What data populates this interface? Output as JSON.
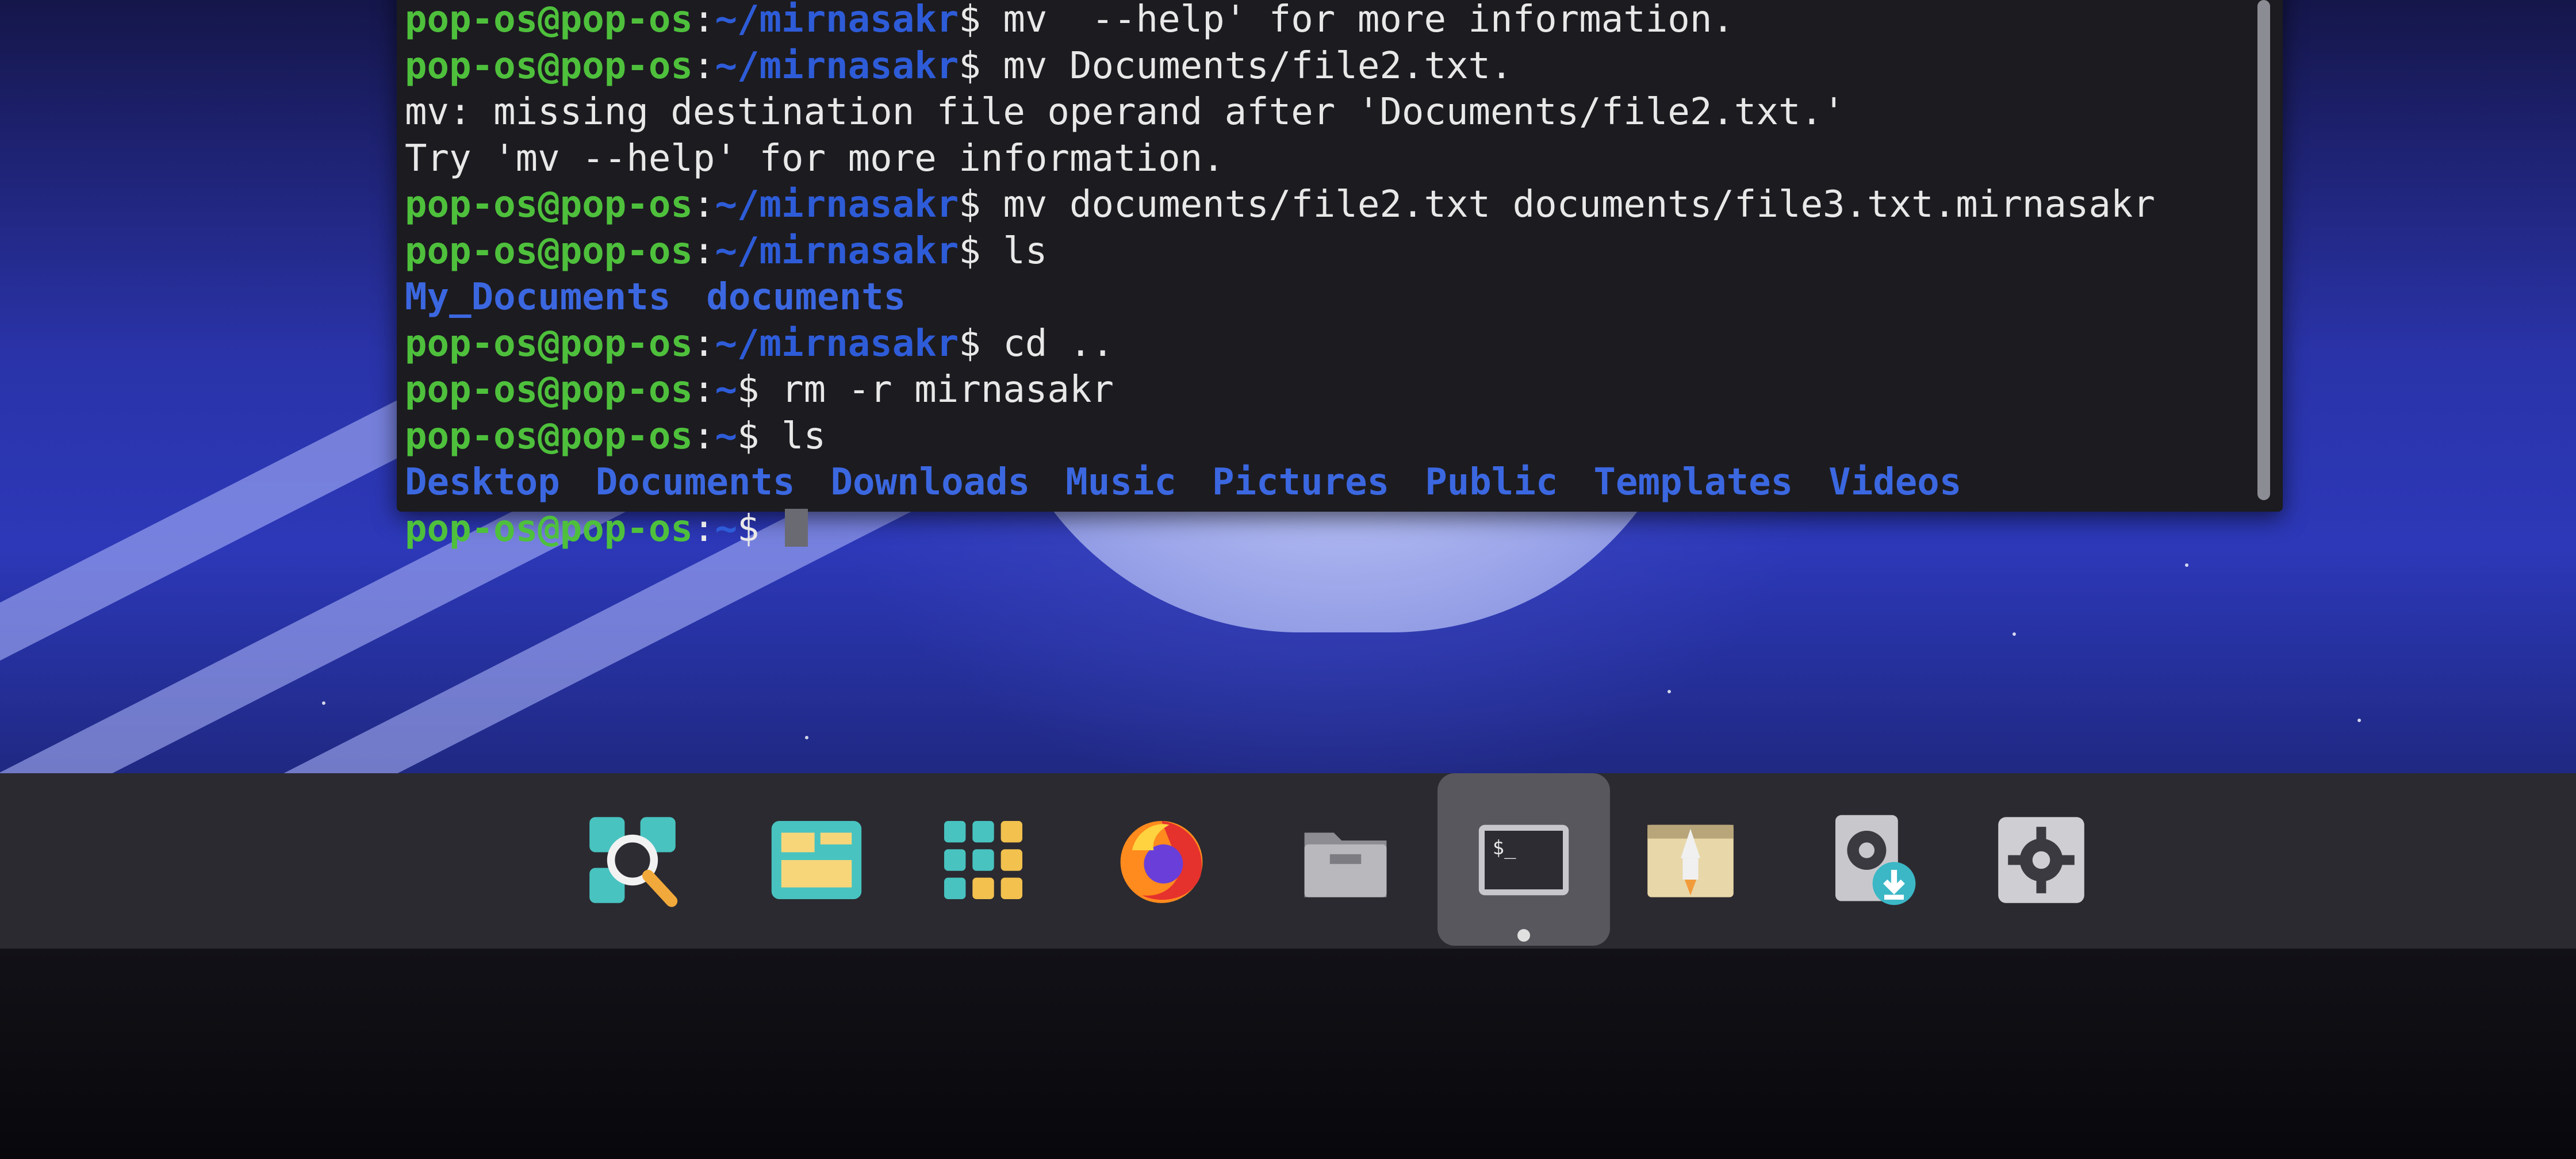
{
  "terminal": {
    "lines": [
      {
        "type": "cmd",
        "user": "pop-os@pop-os",
        "sep": ":",
        "path": "~/mirnasakr",
        "prompt": "$",
        "cmd": " mv  --help' for more information."
      },
      {
        "type": "cmd",
        "user": "pop-os@pop-os",
        "sep": ":",
        "path": "~/mirnasakr",
        "prompt": "$",
        "cmd": " mv Documents/file2.txt."
      },
      {
        "type": "out",
        "text": "mv: missing destination file operand after 'Documents/file2.txt.'"
      },
      {
        "type": "out",
        "text": "Try 'mv --help' for more information."
      },
      {
        "type": "cmd",
        "user": "pop-os@pop-os",
        "sep": ":",
        "path": "~/mirnasakr",
        "prompt": "$",
        "cmd": " mv documents/file2.txt documents/file3.txt.mirnasakr"
      },
      {
        "type": "cmd",
        "user": "pop-os@pop-os",
        "sep": ":",
        "path": "~/mirnasakr",
        "prompt": "$",
        "cmd": " ls"
      },
      {
        "type": "dirs",
        "items": [
          "My_Documents",
          "documents"
        ]
      },
      {
        "type": "cmd",
        "user": "pop-os@pop-os",
        "sep": ":",
        "path": "~/mirnasakr",
        "prompt": "$",
        "cmd": " cd .."
      },
      {
        "type": "cmd",
        "user": "pop-os@pop-os",
        "sep": ":",
        "path": "~",
        "prompt": "$",
        "cmd": " rm -r mirnasakr"
      },
      {
        "type": "cmd",
        "user": "pop-os@pop-os",
        "sep": ":",
        "path": "~",
        "prompt": "$",
        "cmd": " ls"
      },
      {
        "type": "dirs",
        "items": [
          "Desktop",
          "Documents",
          "Downloads",
          "Music",
          "Pictures",
          "Public",
          "Templates",
          "Videos"
        ]
      },
      {
        "type": "prompt",
        "user": "pop-os@pop-os",
        "sep": ":",
        "path": "~",
        "prompt": "$"
      }
    ]
  },
  "dock": {
    "items": [
      {
        "name": "search-app-icon",
        "label": "Search"
      },
      {
        "name": "workspaces-icon",
        "label": "Workspaces"
      },
      {
        "name": "app-grid-icon",
        "label": "Applications"
      },
      {
        "name": "firefox-icon",
        "label": "Firefox"
      },
      {
        "name": "files-icon",
        "label": "Files"
      },
      {
        "name": "terminal-icon",
        "label": "$_",
        "active": true
      },
      {
        "name": "pop-shop-icon",
        "label": "Pop!_Shop"
      },
      {
        "name": "disk-installer-icon",
        "label": "Installer"
      },
      {
        "name": "settings-icon",
        "label": "Settings"
      }
    ]
  },
  "colors": {
    "user": "#4ec03c",
    "path": "#2e5cd8",
    "dir": "#3b67e0",
    "dock": "#2b2a30",
    "terminal_bg": "#1c1b20"
  }
}
